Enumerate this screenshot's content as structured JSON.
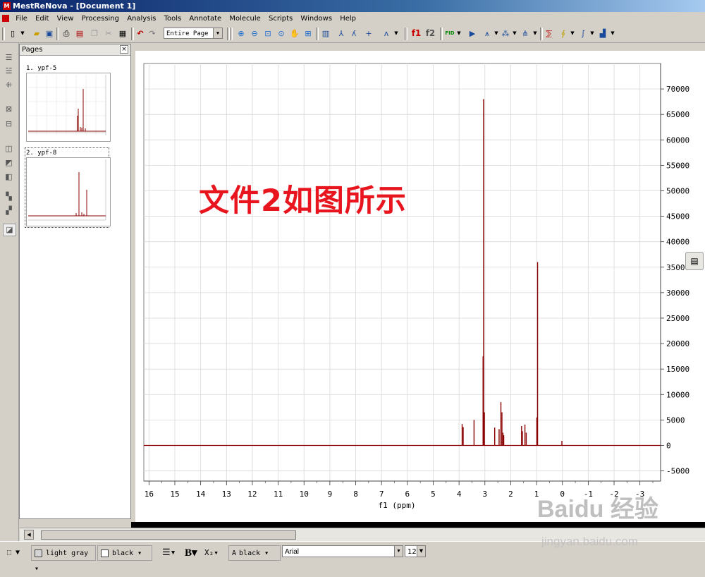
{
  "window": {
    "title": "MestReNova - [Document 1]"
  },
  "menu": [
    "File",
    "Edit",
    "View",
    "Processing",
    "Analysis",
    "Tools",
    "Annotate",
    "Molecule",
    "Scripts",
    "Windows",
    "Help"
  ],
  "toolbar": {
    "zoom_mode": "Entire Page",
    "f1_label": "f1",
    "f2_label": "f2"
  },
  "pages_panel": {
    "title": "Pages",
    "close": "×",
    "items": [
      {
        "label": "1. ypf-5"
      },
      {
        "label": "2. ypf-8"
      }
    ]
  },
  "caption": "文件2如图所示",
  "statusbar": {
    "fill_color": "light gray",
    "line_color": "black",
    "bold": "B",
    "subscript": "X₂",
    "text_color": "black",
    "font": "Arial",
    "font_size": "12"
  },
  "watermark": {
    "brand": "Baidu 经验",
    "url": "jingyan.baidu.com"
  },
  "chart_data": {
    "type": "line",
    "title": "",
    "xlabel": "f1 (ppm)",
    "ylabel": "",
    "x_reversed": true,
    "xlim": [
      16.2,
      -3.8
    ],
    "ylim": [
      -7000,
      75000
    ],
    "x_ticks": [
      16,
      15,
      14,
      13,
      12,
      11,
      10,
      9,
      8,
      7,
      6,
      5,
      4,
      3,
      2,
      1,
      0,
      -1,
      -2,
      -3
    ],
    "x_tick_labels": [
      "16",
      "15",
      "14",
      "13",
      "12",
      "11",
      "10",
      "9",
      "8",
      "7",
      "6",
      "5",
      "4",
      "3",
      "2",
      "1",
      "0",
      "-1",
      "-2",
      "-3"
    ],
    "y_ticks": [
      70000,
      65000,
      60000,
      55000,
      50000,
      45000,
      40000,
      35000,
      30000,
      25000,
      20000,
      15000,
      10000,
      5000,
      0,
      -5000
    ],
    "y_tick_labels": [
      "70000",
      "65000",
      "60000",
      "55000",
      "50000",
      "45000",
      "40000",
      "35000",
      "30000",
      "25000",
      "20000",
      "15000",
      "10000",
      "5000",
      "0",
      "-5000"
    ],
    "grid": true,
    "color": "#8b0000",
    "series": [
      {
        "baseline": 0,
        "peaks": [
          {
            "x": 3.88,
            "y": 4200
          },
          {
            "x": 3.84,
            "y": 3600
          },
          {
            "x": 3.42,
            "y": 5000
          },
          {
            "x": 3.05,
            "y": 68000
          },
          {
            "x": 3.07,
            "y": 17500
          },
          {
            "x": 3.02,
            "y": 6500
          },
          {
            "x": 2.62,
            "y": 3500
          },
          {
            "x": 2.45,
            "y": 3200
          },
          {
            "x": 2.38,
            "y": 8500
          },
          {
            "x": 2.34,
            "y": 6500
          },
          {
            "x": 2.3,
            "y": 2500
          },
          {
            "x": 2.27,
            "y": 2000
          },
          {
            "x": 1.58,
            "y": 3800
          },
          {
            "x": 1.55,
            "y": 2800
          },
          {
            "x": 1.45,
            "y": 4100
          },
          {
            "x": 1.4,
            "y": 2500
          },
          {
            "x": 0.96,
            "y": 36000
          },
          {
            "x": 0.99,
            "y": 5500
          },
          {
            "x": 0.02,
            "y": 900
          }
        ]
      }
    ]
  }
}
